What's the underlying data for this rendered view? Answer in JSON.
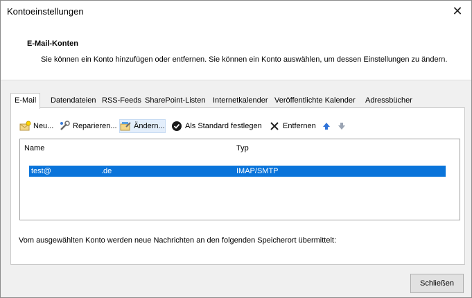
{
  "window": {
    "title": "Kontoeinstellungen"
  },
  "header": {
    "title": "E-Mail-Konten",
    "description": "Sie können ein Konto hinzufügen oder entfernen. Sie können ein Konto auswählen, um dessen Einstellungen zu ändern."
  },
  "tabs": [
    {
      "label": "E-Mail",
      "active": true
    },
    {
      "label": "Datendateien"
    },
    {
      "label": "RSS-Feeds"
    },
    {
      "label": "SharePoint-Listen"
    },
    {
      "label": "Internetkalender"
    },
    {
      "label": "Veröffentlichte Kalender"
    },
    {
      "label": "Adressbücher"
    }
  ],
  "toolbar": {
    "new_label": "Neu...",
    "repair_label": "Reparieren...",
    "change_label": "Ändern...",
    "default_label": "Als Standard festlegen",
    "remove_label": "Entfernen"
  },
  "accounts_table": {
    "columns": [
      "Name",
      "Typ"
    ],
    "rows": [
      {
        "name_part1": "test@",
        "name_part2": ".de",
        "type": "IMAP/SMTP",
        "selected": true
      }
    ]
  },
  "status_text": "Vom ausgewählten Konto werden neue Nachrichten an den folgenden Speicherort übermittelt:",
  "footer": {
    "close_label": "Schließen"
  },
  "colors": {
    "selection": "#0a74da",
    "dialog_bg": "#f0f0f0"
  }
}
